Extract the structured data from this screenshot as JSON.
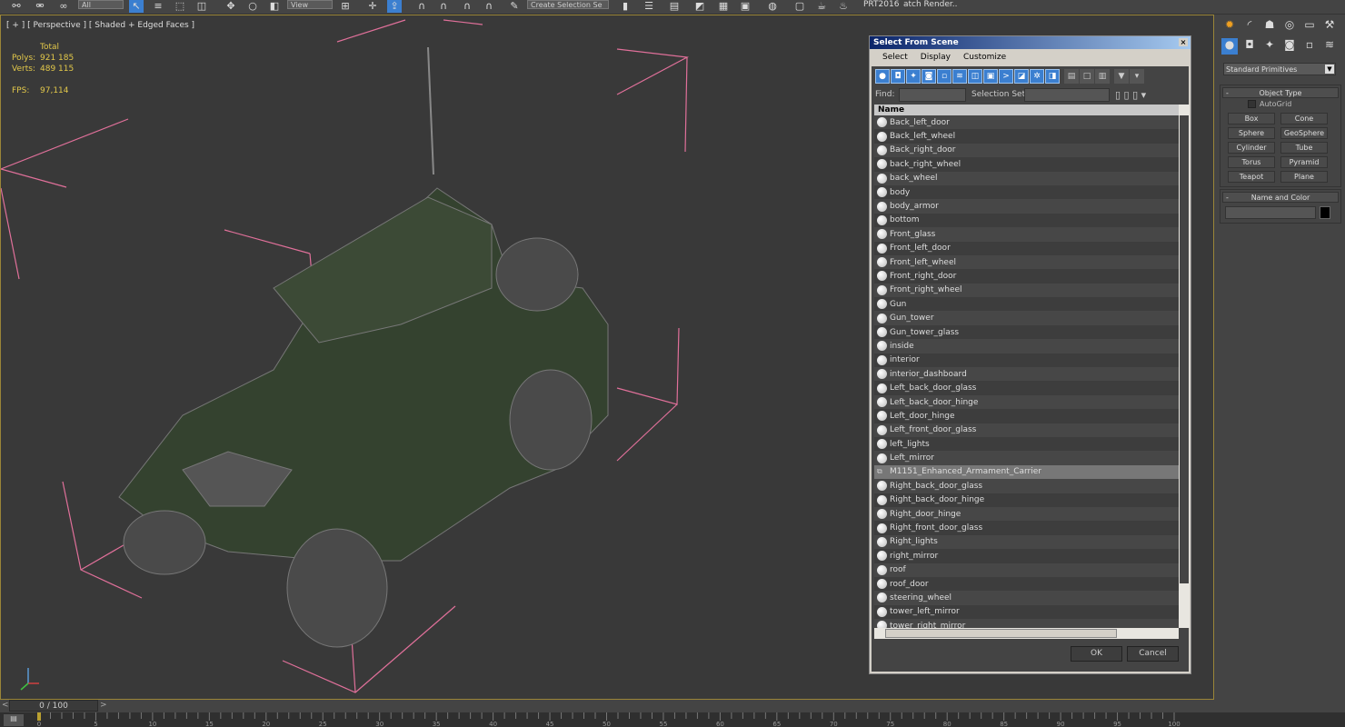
{
  "toolbar": {
    "filter_dropdown": "All",
    "view_dropdown": "View",
    "selection_set": "Create Selection Se",
    "prt_label": "PRT2016",
    "batch_render": "atch Render.."
  },
  "viewport": {
    "label": "[ + ] [ Perspective ] [ Shaded + Edged Faces ]",
    "stats": {
      "header": "Total",
      "polys_label": "Polys:",
      "polys": "921 185",
      "verts_label": "Verts:",
      "verts": "489 115",
      "fps_label": "FPS:",
      "fps": "97,114"
    }
  },
  "dialog": {
    "title": "Select From Scene",
    "menu": [
      "Select",
      "Display",
      "Customize"
    ],
    "find_label": "Find:",
    "find_value": "",
    "selection_set_label": "Selection Set:",
    "column_name": "Name",
    "items": [
      "Back_left_door",
      "Back_left_wheel",
      "Back_right_door",
      "back_right_wheel",
      "back_wheel",
      "body",
      "body_armor",
      "bottom",
      "Front_glass",
      "Front_left_door",
      "Front_left_wheel",
      "Front_right_door",
      "Front_right_wheel",
      "Gun",
      "Gun_tower",
      "Gun_tower_glass",
      "inside",
      "interior",
      "interior_dashboard",
      "Left_back_door_glass",
      "Left_back_door_hinge",
      "Left_door_hinge",
      "Left_front_door_glass",
      "left_lights",
      "Left_mirror",
      "M1151_Enhanced_Armament_Carrier",
      "Right_back_door_glass",
      "Right_back_door_hinge",
      "Right_door_hinge",
      "Right_front_door_glass",
      "Right_lights",
      "right_mirror",
      "roof",
      "roof_door",
      "steering_wheel",
      "tower_left_mirror",
      "tower_right_mirror"
    ],
    "selected_item": "M1151_Enhanced_Armament_Carrier",
    "ok": "OK",
    "cancel": "Cancel"
  },
  "command_panel": {
    "category": "Standard Primitives",
    "object_type": {
      "title": "Object Type",
      "autogrid": "AutoGrid",
      "autogrid_checked": false,
      "buttons": [
        "Box",
        "Cone",
        "Sphere",
        "GeoSphere",
        "Cylinder",
        "Tube",
        "Torus",
        "Pyramid",
        "Teapot",
        "Plane"
      ]
    },
    "name_and_color": {
      "title": "Name and Color",
      "name": "",
      "color": "#000000"
    }
  },
  "timeline": {
    "frame": "0 / 100",
    "ticks": [
      "0",
      "5",
      "10",
      "15",
      "20",
      "25",
      "30",
      "35",
      "40",
      "45",
      "50",
      "55",
      "60",
      "65",
      "70",
      "75",
      "80",
      "85",
      "90",
      "95",
      "100"
    ]
  },
  "colors": {
    "accent": "#3b7fd0",
    "viewport_border": "#9a8538",
    "stats": "#e2c84a",
    "bbox": "#e0709a"
  }
}
